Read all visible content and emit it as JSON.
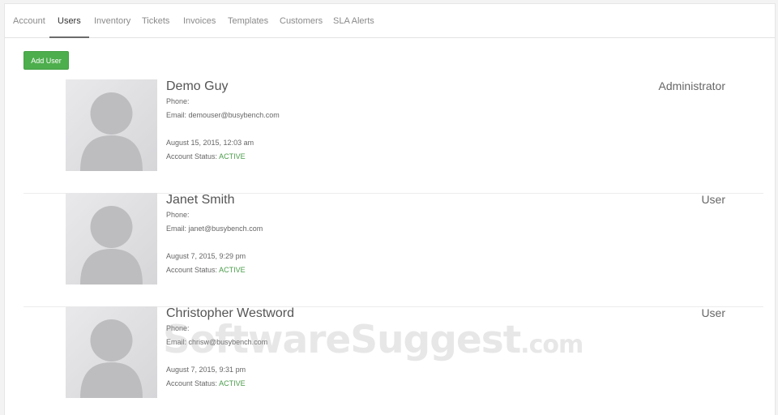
{
  "tabs": [
    {
      "label": "Account"
    },
    {
      "label": "Users"
    },
    {
      "label": "Inventory"
    },
    {
      "label": "Tickets"
    },
    {
      "label": "Invoices"
    },
    {
      "label": "Templates"
    },
    {
      "label": "Customers"
    },
    {
      "label": "SLA Alerts"
    }
  ],
  "active_tab": "Users",
  "add_user_label": "Add User",
  "users": [
    {
      "name": "Demo Guy",
      "phone_label": "Phone:",
      "email_text": "Email: demouser@busybench.com",
      "date": "August 15, 2015, 12:03 am",
      "status_label": "Account Status:",
      "status": "ACTIVE",
      "role": "Administrator"
    },
    {
      "name": "Janet Smith",
      "phone_label": "Phone:",
      "email_text": "Email: janet@busybench.com",
      "date": "August 7, 2015, 9:29 pm",
      "status_label": "Account Status:",
      "status": "ACTIVE",
      "role": "User"
    },
    {
      "name": "Christopher Westword",
      "phone_label": "Phone:",
      "email_text": "Email: chrisw@busybench.com",
      "date": "August 7, 2015, 9:31 pm",
      "status_label": "Account Status:",
      "status": "ACTIVE",
      "role": "User"
    }
  ],
  "colors": {
    "accent_green": "#4cae4c",
    "status_active": "#4a9b4a"
  },
  "watermark": {
    "main": "SoftwareSuggest",
    "suffix": ".com"
  }
}
